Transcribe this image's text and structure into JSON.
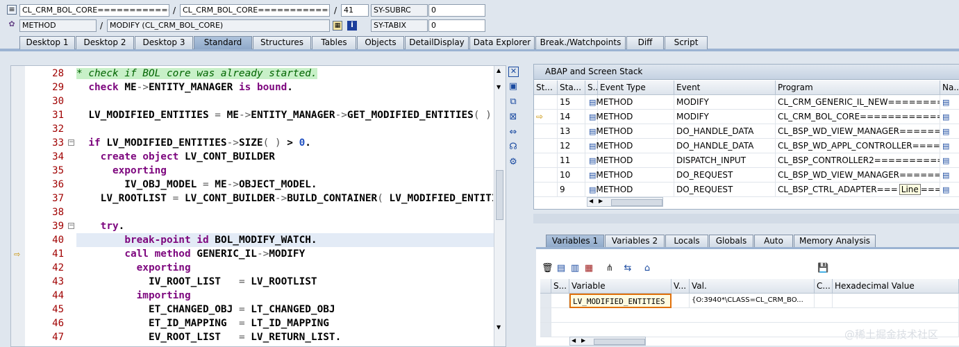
{
  "header": {
    "row1": {
      "field1": "CL_CRM_BOL_CORE===============...",
      "field2": "CL_CRM_BOL_CORE===============...",
      "line": "41",
      "sysvar_name": "SY-SUBRC",
      "sysvar_value": "0"
    },
    "row2": {
      "field1": "METHOD",
      "field2": "MODIFY (CL_CRM_BOL_CORE)",
      "sysvar_name": "SY-TABIX",
      "sysvar_value": "0"
    },
    "slash": "/"
  },
  "tabs": [
    {
      "label": "Desktop 1"
    },
    {
      "label": "Desktop 2"
    },
    {
      "label": "Desktop 3"
    },
    {
      "label": "Standard"
    },
    {
      "label": "Structures"
    },
    {
      "label": "Tables"
    },
    {
      "label": "Objects"
    },
    {
      "label": "DetailDisplay"
    },
    {
      "label": "Data Explorer"
    },
    {
      "label": "Break./Watchpoints"
    },
    {
      "label": "Diff"
    },
    {
      "label": "Script"
    }
  ],
  "active_tab": "Standard",
  "editor": {
    "lines": [
      {
        "no": "28",
        "code": "* check if BOL core was already started."
      },
      {
        "no": "29",
        "code": "  check ME->ENTITY_MANAGER is bound."
      },
      {
        "no": "30",
        "code": ""
      },
      {
        "no": "31",
        "code": "  LV_MODIFIED_ENTITIES = ME->ENTITY_MANAGER->GET_MODIFIED_ENTITIES( )."
      },
      {
        "no": "32",
        "code": ""
      },
      {
        "no": "33",
        "code": "  if LV_MODIFIED_ENTITIES->SIZE( ) > 0."
      },
      {
        "no": "34",
        "code": "    create object LV_CONT_BUILDER"
      },
      {
        "no": "35",
        "code": "      exporting"
      },
      {
        "no": "36",
        "code": "        IV_OBJ_MODEL = ME->OBJECT_MODEL."
      },
      {
        "no": "37",
        "code": "    LV_ROOTLIST = LV_CONT_BUILDER->BUILD_CONTAINER( LV_MODIFIED_ENTITIES )."
      },
      {
        "no": "38",
        "code": ""
      },
      {
        "no": "39",
        "code": "    try."
      },
      {
        "no": "40",
        "code": "        break-point id BOL_MODIFY_WATCH."
      },
      {
        "no": "41",
        "code": "        call method GENERIC_IL->MODIFY"
      },
      {
        "no": "42",
        "code": "          exporting"
      },
      {
        "no": "43",
        "code": "            IV_ROOT_LIST   = LV_ROOTLIST"
      },
      {
        "no": "44",
        "code": "          importing"
      },
      {
        "no": "45",
        "code": "            ET_CHANGED_OBJ = LT_CHANGED_OBJ"
      },
      {
        "no": "46",
        "code": "            ET_ID_MAPPING  = LT_ID_MAPPING"
      },
      {
        "no": "47",
        "code": "            EV_ROOT_LIST   = LV_RETURN_LIST."
      }
    ]
  },
  "stack": {
    "title": "ABAP and Screen Stack",
    "columns": [
      "St...",
      "Sta...",
      "S...",
      "Event Type",
      "Event",
      "Program",
      "Na..."
    ],
    "rows": [
      {
        "level": "15",
        "type": "METHOD",
        "event": "MODIFY",
        "program": "CL_CRM_GENERIC_IL_NEW========...",
        "current": false
      },
      {
        "level": "14",
        "type": "METHOD",
        "event": "MODIFY",
        "program": "CL_CRM_BOL_CORE==============...",
        "current": true
      },
      {
        "level": "13",
        "type": "METHOD",
        "event": "DO_HANDLE_DATA",
        "program": "CL_BSP_WD_VIEW_MANAGER======...",
        "current": false
      },
      {
        "level": "12",
        "type": "METHOD",
        "event": "DO_HANDLE_DATA",
        "program": "CL_BSP_WD_APPL_CONTROLLER=====...",
        "current": false
      },
      {
        "level": "11",
        "type": "METHOD",
        "event": "DISPATCH_INPUT",
        "program": "CL_BSP_CONTROLLER2===========...",
        "current": false
      },
      {
        "level": "10",
        "type": "METHOD",
        "event": "DO_REQUEST",
        "program": "CL_BSP_WD_VIEW_MANAGER======...",
        "current": false
      },
      {
        "level": "9",
        "type": "METHOD",
        "event": "DO_REQUEST",
        "program": "CL_BSP_CTRL_ADAPTER===",
        "current": false
      }
    ],
    "tooltip": "Line",
    "tooltip_tail": "====..."
  },
  "var_tabs": [
    {
      "label": "Variables 1"
    },
    {
      "label": "Variables 2"
    },
    {
      "label": "Locals"
    },
    {
      "label": "Globals"
    },
    {
      "label": "Auto"
    },
    {
      "label": "Memory Analysis"
    }
  ],
  "vars": {
    "columns": [
      "S...",
      "Variable",
      "V...",
      "Val.",
      "C...",
      "Hexadecimal Value"
    ],
    "rows": [
      {
        "variable": "LV_MODIFIED_ENTITIES",
        "value": "{O:3940*\\CLASS=CL_CRM_BO..."
      }
    ]
  },
  "watermark": "@稀土掘金技术社区",
  "colors": {
    "keyword": "#7d067e",
    "comment_bg": "#c8f0c8",
    "active_tab": "#9bb3d2"
  }
}
